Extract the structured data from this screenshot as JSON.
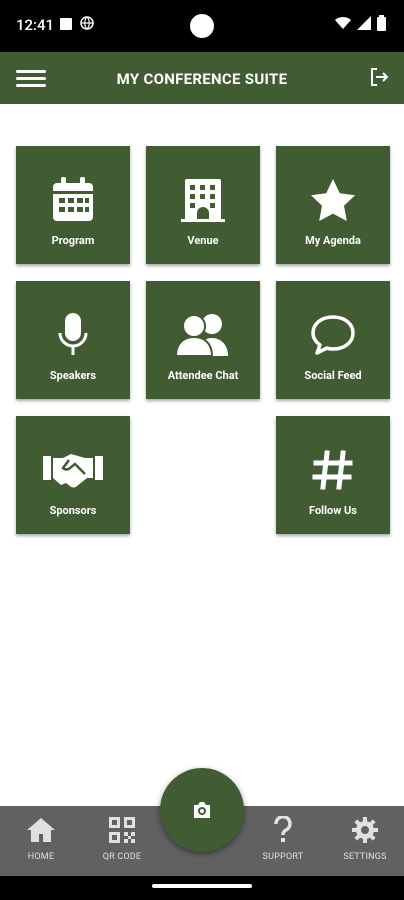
{
  "status": {
    "time": "12:41"
  },
  "appbar": {
    "title": "MY CONFERENCE SUITE",
    "menu_icon": "hamburger-icon",
    "logout_icon": "logout-icon"
  },
  "tiles": [
    {
      "label": "Program",
      "icon": "calendar-icon"
    },
    {
      "label": "Venue",
      "icon": "building-icon"
    },
    {
      "label": "My Agenda",
      "icon": "star-icon"
    },
    {
      "label": "Speakers",
      "icon": "microphone-icon"
    },
    {
      "label": "Attendee Chat",
      "icon": "users-icon"
    },
    {
      "label": "Social Feed",
      "icon": "chat-bubble-icon"
    },
    {
      "label": "Sponsors",
      "icon": "handshake-icon"
    },
    {
      "label": "Follow Us",
      "icon": "hashtag-icon"
    }
  ],
  "bottom_nav": [
    {
      "label": "HOME",
      "icon": "home-icon"
    },
    {
      "label": "QR CODE",
      "icon": "qr-code-icon"
    },
    {
      "label": "SUPPORT",
      "icon": "question-icon"
    },
    {
      "label": "SETTINGS",
      "icon": "gear-icon"
    }
  ],
  "fab": {
    "icon": "camera-icon"
  },
  "colors": {
    "primary": "#415b33",
    "bottom_bar": "#616161"
  }
}
